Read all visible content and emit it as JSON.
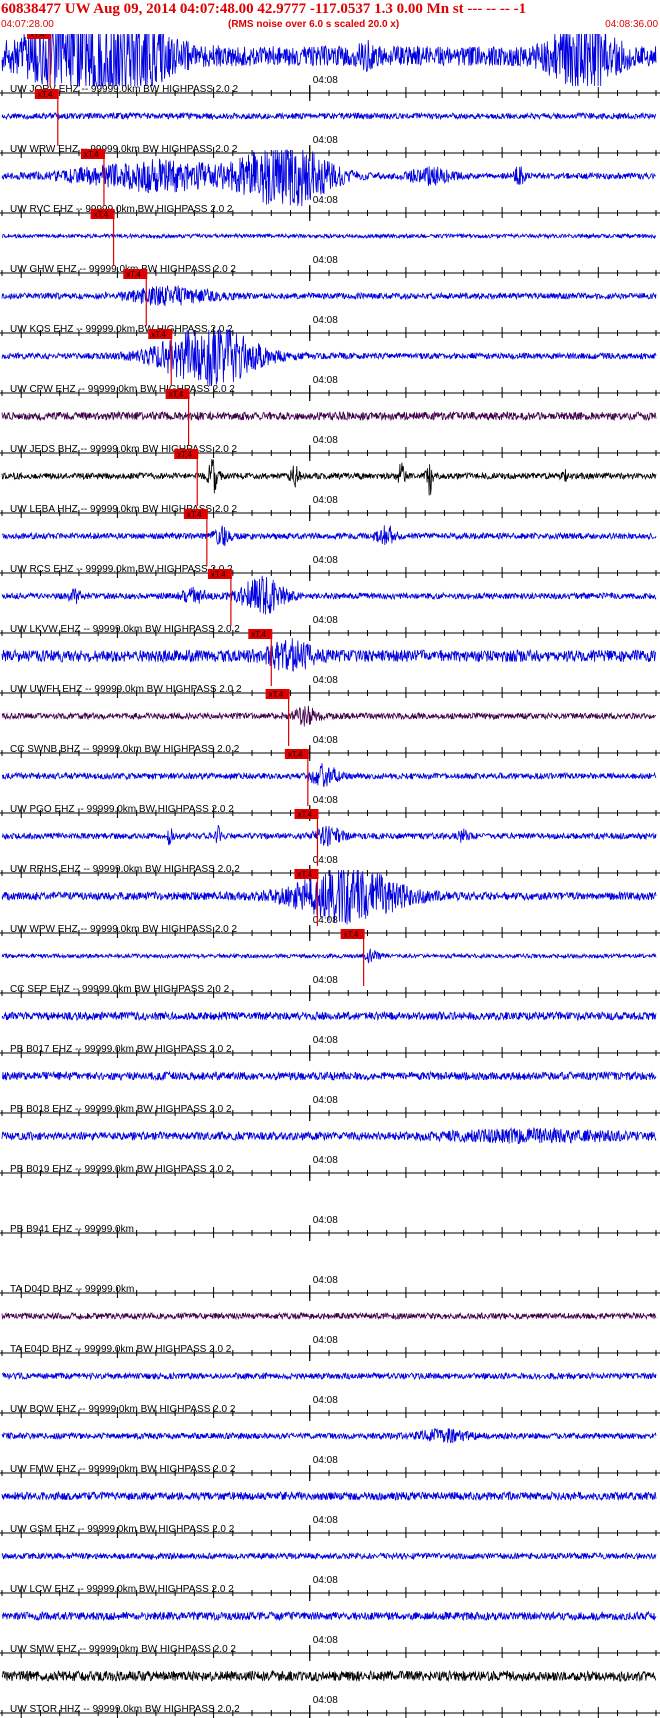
{
  "header": {
    "title": "60838477 UW Aug 09, 2014 04:07:48.00   42.9777 -117.0537  1.3 0.00 Mn st --- -- --  -1",
    "start_time": "04:07:28.00",
    "rms_note": "(RMS noise over 6.0 s scaled 20.0 x)",
    "end_time": "04:08:36.00"
  },
  "colors": {
    "header_text": "#e00000",
    "trace_blue": "#0000e0",
    "trace_black": "#000000",
    "trace_purple": "#40004a",
    "pick_red": "#e00000",
    "axis": "#000000"
  },
  "chart_data": {
    "type": "line",
    "title": "60838477 UW Aug 09, 2014 04:07:48.00",
    "x_axis": {
      "start": "04:07:28.00",
      "end": "04:08:36.00",
      "units": "seconds",
      "tick_label": "04:08",
      "tick_label_seconds": 32
    },
    "duration_s": 68,
    "pick_label": "xT.4",
    "traces": [
      {
        "label": "UW JORV EHZ -- 99999.0km BW  HIGHPASS  2.0  2",
        "color": "blue",
        "noise": 10,
        "pick_s": 5.0,
        "bursts": [
          [
            9.5,
            7.5,
            38
          ],
          [
            60.5,
            3.5,
            34
          ],
          [
            13.8,
            3.0,
            10
          ],
          [
            37.8,
            0.8,
            8
          ]
        ]
      },
      {
        "label": "UW WRW EHZ -- 99999.0km BW  HIGHPASS  2.0  2",
        "color": "blue",
        "noise": 3,
        "pick_s": 5.8,
        "bursts": []
      },
      {
        "label": "UW RVC EHZ -- 99999.0km BW  HIGHPASS  2.0  2",
        "color": "blue",
        "noise": 3,
        "pick_s": 10.6,
        "bursts": [
          [
            16.0,
            9.0,
            14
          ],
          [
            29.5,
            5.0,
            32
          ],
          [
            44.5,
            2.5,
            7
          ],
          [
            53.8,
            0.5,
            10
          ]
        ]
      },
      {
        "label": "UW GHW EHZ -- 99999.0km BW  HIGHPASS  2.0  2",
        "color": "blue",
        "noise": 2,
        "pick_s": 11.6,
        "bursts": []
      },
      {
        "label": "UW KOS EHZ -- 99999.0km BW  HIGHPASS  2.0  2",
        "color": "blue",
        "noise": 3,
        "pick_s": 15.0,
        "bursts": [
          [
            17.5,
            5.0,
            8
          ]
        ]
      },
      {
        "label": "UW CPW EHZ -- 99999.0km BW  HIGHPASS  2.0  2",
        "color": "blue",
        "noise": 3,
        "pick_s": 17.6,
        "bursts": [
          [
            21.5,
            5.5,
            30
          ]
        ]
      },
      {
        "label": "UW JEDS BHZ -- 99999.0km BW  HIGHPASS  2.0  2",
        "color": "purple",
        "noise": 4,
        "pick_s": 19.4,
        "bursts": []
      },
      {
        "label": "UW LEBA HHZ -- 99999.0km BW  HIGHPASS  2.0  2",
        "color": "black",
        "noise": 3,
        "pick_s": 20.3,
        "bursts": [
          [
            22.0,
            0.6,
            16
          ],
          [
            30.5,
            0.5,
            10
          ],
          [
            41.5,
            0.4,
            12
          ],
          [
            44.5,
            0.4,
            18
          ],
          [
            58.5,
            0.3,
            8
          ]
        ]
      },
      {
        "label": "UW RCS EHZ -- 99999.0km BW  HIGHPASS  2.0  2",
        "color": "blue",
        "noise": 3,
        "pick_s": 21.3,
        "bursts": [
          [
            23.0,
            1.0,
            8
          ],
          [
            40.0,
            1.0,
            10
          ]
        ]
      },
      {
        "label": "UW LKVW EHZ -- 99999.0km BW  HIGHPASS  2.0  2",
        "color": "blue",
        "noise": 3,
        "pick_s": 23.8,
        "bursts": [
          [
            27.0,
            2.5,
            18
          ],
          [
            20.0,
            1.2,
            8
          ],
          [
            7.5,
            0.6,
            7
          ]
        ]
      },
      {
        "label": "UW UWFH EHZ -- 99999.0km BW  HIGHPASS  2.0  2",
        "color": "blue",
        "noise": 6,
        "pick_s": 28.0,
        "bursts": [
          [
            30.0,
            2.5,
            12
          ]
        ]
      },
      {
        "label": "CC SWNB BHZ -- 99999.0km BW  HIGHPASS  2.0  2",
        "color": "purple",
        "noise": 3,
        "pick_s": 29.8,
        "bursts": [
          [
            31.5,
            1.5,
            8
          ]
        ]
      },
      {
        "label": "UW PGO EHZ -- 99999.0km BW  HIGHPASS  2.0  2",
        "color": "blue",
        "noise": 3,
        "pick_s": 31.8,
        "bursts": [
          [
            33.5,
            1.5,
            10
          ]
        ]
      },
      {
        "label": "UW RRHS EHZ -- 99999.0km BW  HIGHPASS  2.0  2",
        "color": "blue",
        "noise": 3,
        "pick_s": 32.8,
        "bursts": [
          [
            34.0,
            1.5,
            8
          ],
          [
            17.5,
            0.3,
            8
          ],
          [
            22.5,
            0.3,
            8
          ],
          [
            48.0,
            0.5,
            8
          ]
        ]
      },
      {
        "label": "UW WPW EHZ -- 99999.0km BW  HIGHPASS  2.0  2",
        "color": "blue",
        "noise": 4,
        "pick_s": 32.8,
        "bursts": [
          [
            36.0,
            6.0,
            26
          ]
        ]
      },
      {
        "label": "CC SEP EHZ -- 99999.0km BW  HIGHPASS  2.0  2",
        "color": "blue",
        "noise": 2,
        "pick_s": 37.6,
        "bursts": [
          [
            38.5,
            0.8,
            6
          ]
        ]
      },
      {
        "label": "PB B017 EHZ -- 99999.0km BW  HIGHPASS  2.0  2",
        "color": "blue",
        "noise": 4,
        "pick_s": null,
        "bursts": []
      },
      {
        "label": "PB B018 EHZ -- 99999.0km BW  HIGHPASS  2.0  2",
        "color": "blue",
        "noise": 4,
        "pick_s": null,
        "bursts": []
      },
      {
        "label": "PB B019 EHZ -- 99999.0km BW  HIGHPASS  2.0  2",
        "color": "blue",
        "noise": 4,
        "pick_s": null,
        "bursts": [
          [
            55.0,
            10.0,
            4
          ]
        ]
      },
      {
        "label": "PB B941 EHZ -- 99999.0km",
        "color": "blue",
        "noise": 0,
        "pick_s": null,
        "bursts": []
      },
      {
        "label": "TA D04D BHZ -- 99999.0km",
        "color": "blue",
        "noise": 0,
        "pick_s": null,
        "bursts": []
      },
      {
        "label": "TA E04D BHZ -- 99999.0km BW  HIGHPASS  2.0  2",
        "color": "purple",
        "noise": 3,
        "pick_s": null,
        "bursts": []
      },
      {
        "label": "UW BOW EHZ -- 99999.0km BW  HIGHPASS  2.0  2",
        "color": "blue",
        "noise": 3,
        "pick_s": null,
        "bursts": []
      },
      {
        "label": "UW FMW EHZ -- 99999.0km BW  HIGHPASS  2.0  2",
        "color": "blue",
        "noise": 3,
        "pick_s": null,
        "bursts": [
          [
            46.0,
            3.0,
            5
          ]
        ]
      },
      {
        "label": "UW GSM EHZ -- 99999.0km BW  HIGHPASS  2.0  2",
        "color": "blue",
        "noise": 4,
        "pick_s": null,
        "bursts": []
      },
      {
        "label": "UW LCW EHZ -- 99999.0km BW  HIGHPASS  2.0  2",
        "color": "blue",
        "noise": 3,
        "pick_s": null,
        "bursts": []
      },
      {
        "label": "UW SMW EHZ -- 99999.0km BW  HIGHPASS  2.0  2",
        "color": "blue",
        "noise": 4,
        "pick_s": null,
        "bursts": []
      },
      {
        "label": "UW STOR HHZ -- 99999.0km BW  HIGHPASS  2.0  2",
        "color": "black",
        "noise": 5,
        "pick_s": null,
        "bursts": []
      }
    ]
  }
}
